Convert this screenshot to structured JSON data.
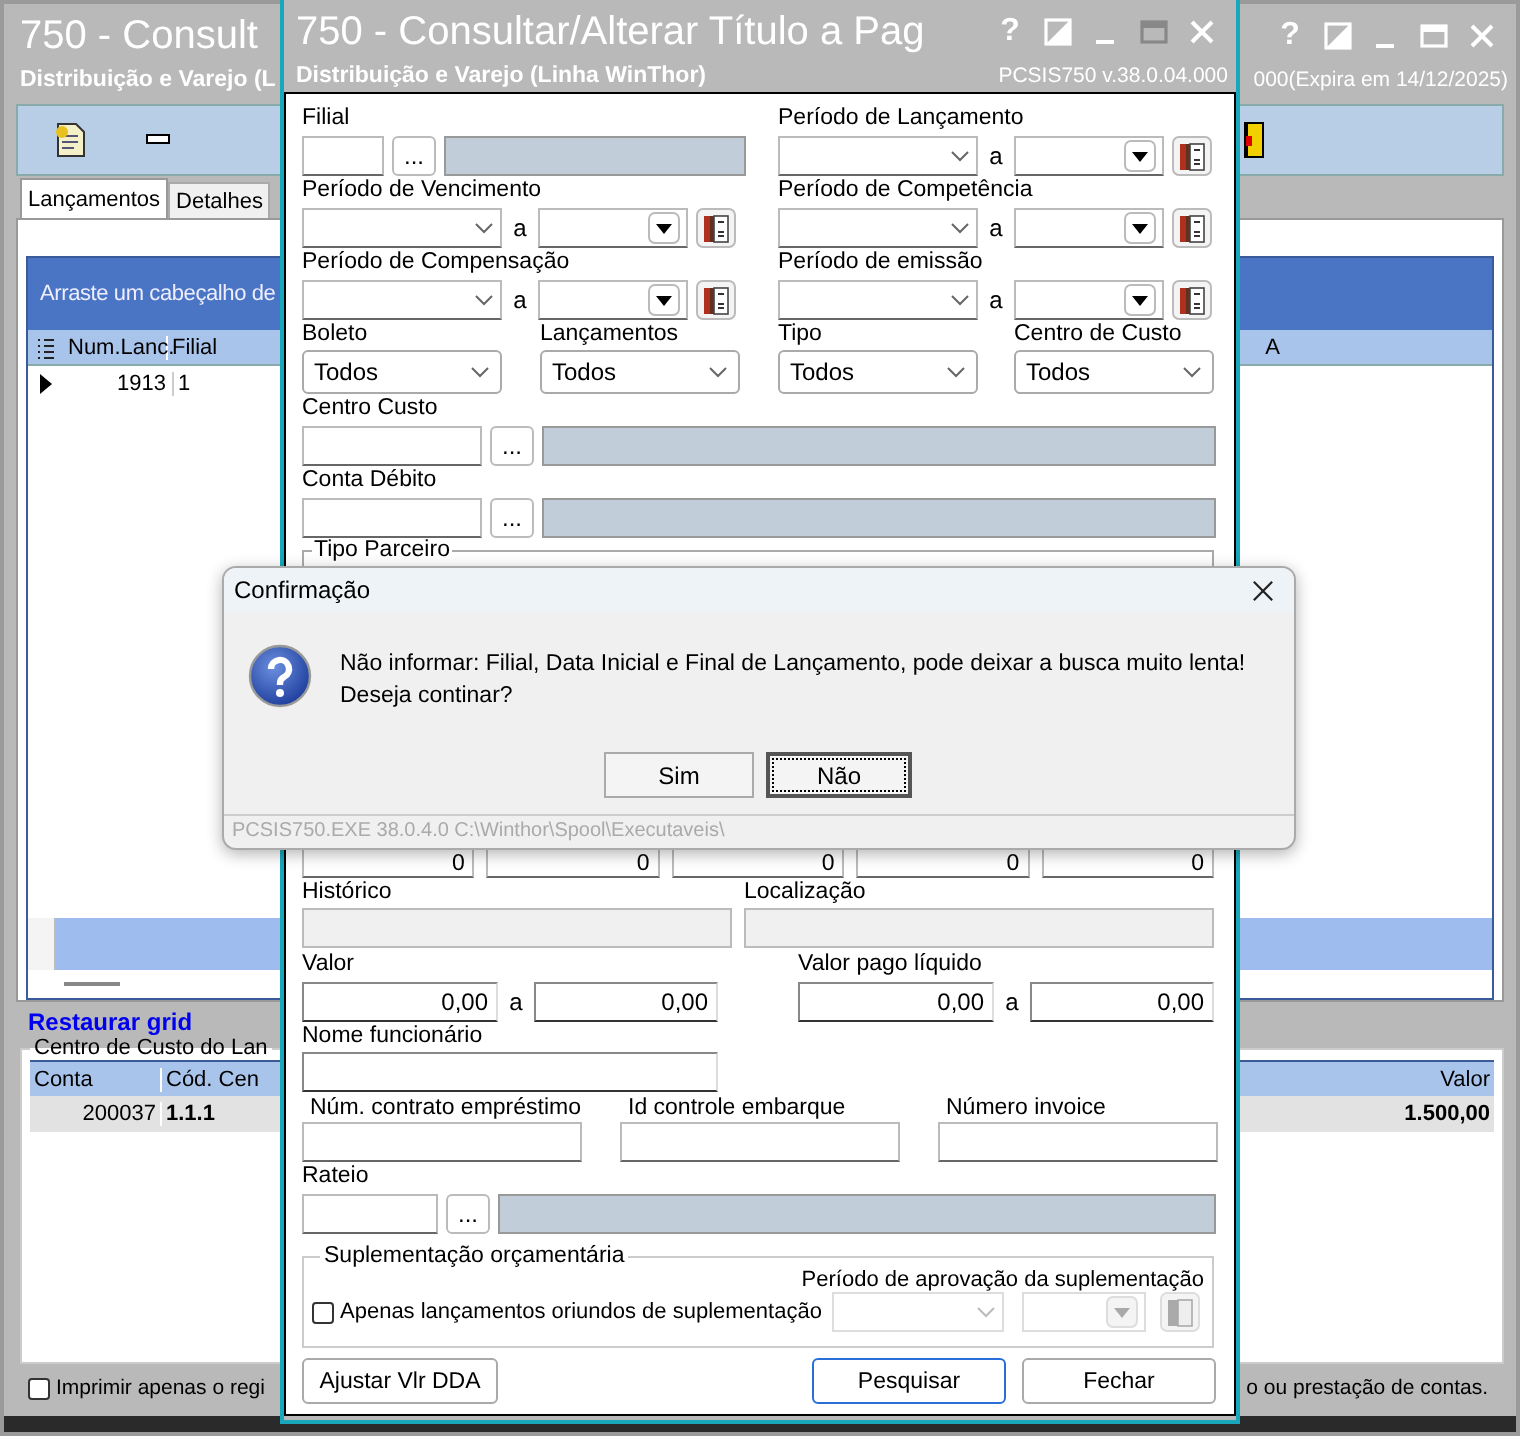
{
  "background_window": {
    "title": "750 - Consult",
    "subtitle": "Distribuição e Varejo (L",
    "subtitle_right": "000(Expira em 14/12/2025)",
    "help": "?",
    "tabs": [
      {
        "label": "Lançamentos",
        "selected": true
      },
      {
        "label": "Detalhes",
        "selected": false
      }
    ],
    "grid": {
      "group_hint": "Arraste um cabeçalho de",
      "columns": [
        "Num.Lanc.",
        "Filial"
      ],
      "column_3": "A",
      "rows": [
        [
          "1913",
          "1"
        ]
      ]
    },
    "restore_link": "Restaurar grid",
    "cost_center": {
      "title": "Centro de Custo do Lan",
      "columns": [
        "Conta",
        "Cód. Cen"
      ],
      "right_column": "Valor",
      "rows": [
        {
          "cells": [
            "200037",
            "1.1.1"
          ],
          "value": "1.500,00"
        }
      ]
    },
    "print_option": {
      "label": "Imprimir apenas o regi",
      "label_right": "o ou prestação de contas.",
      "checked": false
    }
  },
  "window": {
    "title": "750 - Consultar/Alterar Título a Pag",
    "subtitle": "Distribuição e Varejo (Linha WinThor)",
    "version": "PCSIS750  v.38.0.04.000",
    "help": "?"
  },
  "form": {
    "filial": {
      "label": "Filial",
      "button": "..."
    },
    "periods": [
      {
        "label": "Período de Lançamento",
        "separator": "a"
      },
      {
        "label": "Período de Vencimento",
        "separator": "a"
      },
      {
        "label": "Período de Competência",
        "separator": "a"
      },
      {
        "label": "Período de Compensação",
        "separator": "a"
      },
      {
        "label": "Período de emissão",
        "separator": "a"
      }
    ],
    "selects": [
      {
        "label": "Boleto",
        "value": "Todos"
      },
      {
        "label": "Lançamentos",
        "value": "Todos"
      },
      {
        "label": "Tipo",
        "value": "Todos"
      },
      {
        "label": "Centro de Custo",
        "value": "Todos"
      }
    ],
    "lookups": [
      {
        "label": "Centro Custo",
        "button": "..."
      },
      {
        "label": "Conta Débito",
        "button": "..."
      }
    ],
    "partner_group": "Tipo Parceiro",
    "zero_fields": [
      "0",
      "0",
      "0",
      "0",
      "0"
    ],
    "historico": "Histórico",
    "localizacao": "Localização",
    "ranges": [
      {
        "label": "Valor",
        "from": "0,00",
        "separator": "a",
        "to": "0,00"
      },
      {
        "label": "Valor pago líquido",
        "from": "0,00",
        "separator": "a",
        "to": "0,00"
      }
    ],
    "nome_funcionario": "Nome funcionário",
    "text_fields": [
      "Núm. contrato empréstimo",
      "Id controle embarque",
      "Número invoice"
    ],
    "rateio": {
      "label": "Rateio",
      "button": "..."
    },
    "supplement": {
      "title": "Suplementação orçamentária",
      "period_label": "Período de aprovação da suplementação",
      "checkbox_label": "Apenas lançamentos oriundos de suplementação",
      "checked": false
    },
    "buttons": [
      {
        "label": "Ajustar Vlr DDA",
        "focused": false
      },
      {
        "label": "Pesquisar",
        "focused": true
      },
      {
        "label": "Fechar",
        "focused": false
      }
    ]
  },
  "dialog": {
    "title": "Confirmação",
    "message": [
      "Não informar: Filial, Data Inicial e Final de Lançamento, pode deixar a busca muito lenta!",
      "Deseja continar?"
    ],
    "buttons": [
      {
        "label": "Sim",
        "focused": false
      },
      {
        "label": "Não",
        "focused": true
      }
    ],
    "footer": "PCSIS750.EXE 38.0.4.0 C:\\Winthor\\Spool\\Executaveis\\"
  }
}
